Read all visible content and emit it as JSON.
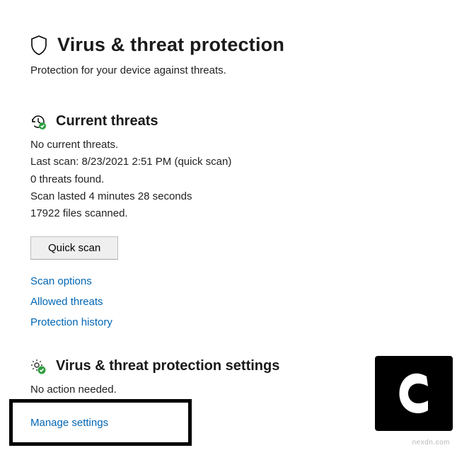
{
  "header": {
    "title": "Virus & threat protection",
    "subtitle": "Protection for your device against threats."
  },
  "current_threats": {
    "heading": "Current threats",
    "no_threats": "No current threats.",
    "last_scan": "Last scan: 8/23/2021 2:51 PM (quick scan)",
    "threats_found": "0 threats found.",
    "scan_duration": "Scan lasted 4 minutes 28 seconds",
    "files_scanned": "17922 files scanned.",
    "quick_scan_label": "Quick scan",
    "links": {
      "scan_options": "Scan options",
      "allowed_threats": "Allowed threats",
      "protection_history": "Protection history"
    }
  },
  "settings": {
    "heading": "Virus & threat protection settings",
    "status": "No action needed.",
    "manage_link": "Manage settings"
  },
  "watermark": "nexdn.com"
}
